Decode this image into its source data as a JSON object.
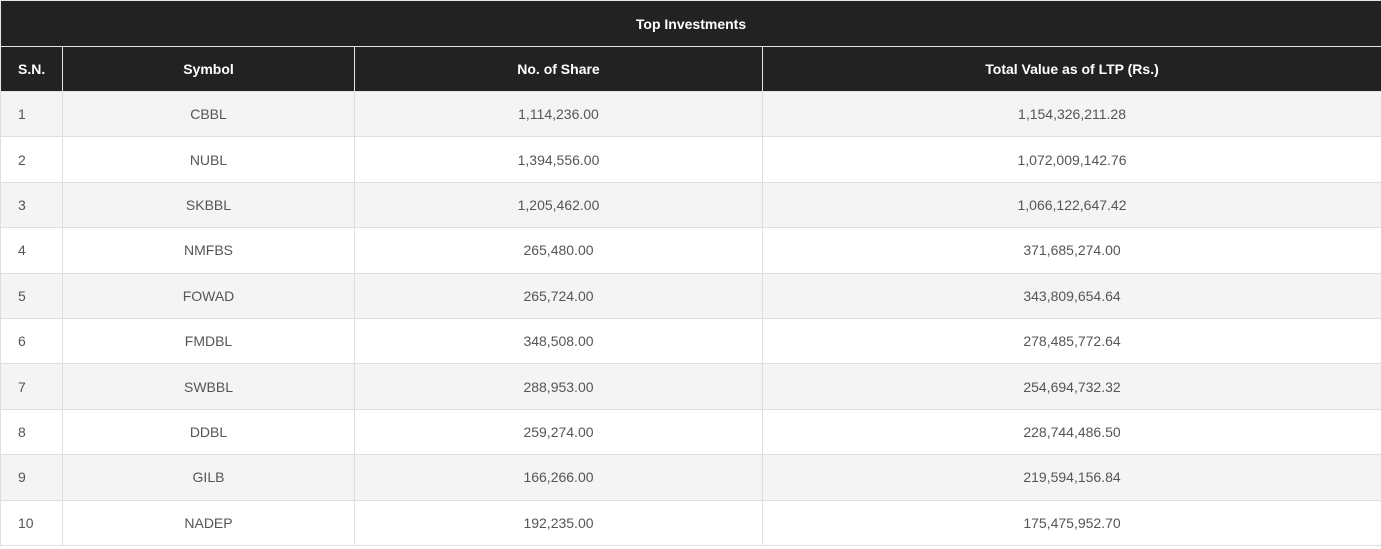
{
  "table": {
    "title": "Top Investments",
    "columns": [
      "S.N.",
      "Symbol",
      "No. of Share",
      "Total Value as of LTP (Rs.)"
    ],
    "rows": [
      {
        "sn": "1",
        "symbol": "CBBL",
        "shares": "1,114,236.00",
        "value": "1,154,326,211.28"
      },
      {
        "sn": "2",
        "symbol": "NUBL",
        "shares": "1,394,556.00",
        "value": "1,072,009,142.76"
      },
      {
        "sn": "3",
        "symbol": "SKBBL",
        "shares": "1,205,462.00",
        "value": "1,066,122,647.42"
      },
      {
        "sn": "4",
        "symbol": "NMFBS",
        "shares": "265,480.00",
        "value": "371,685,274.00"
      },
      {
        "sn": "5",
        "symbol": "FOWAD",
        "shares": "265,724.00",
        "value": "343,809,654.64"
      },
      {
        "sn": "6",
        "symbol": "FMDBL",
        "shares": "348,508.00",
        "value": "278,485,772.64"
      },
      {
        "sn": "7",
        "symbol": "SWBBL",
        "shares": "288,953.00",
        "value": "254,694,732.32"
      },
      {
        "sn": "8",
        "symbol": "DDBL",
        "shares": "259,274.00",
        "value": "228,744,486.50"
      },
      {
        "sn": "9",
        "symbol": "GILB",
        "shares": "166,266.00",
        "value": "219,594,156.84"
      },
      {
        "sn": "10",
        "symbol": "NADEP",
        "shares": "192,235.00",
        "value": "175,475,952.70"
      }
    ]
  }
}
